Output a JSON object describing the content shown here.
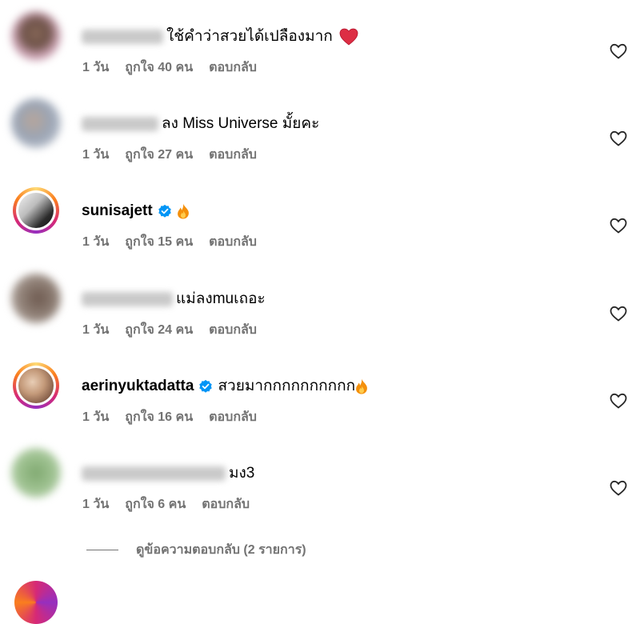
{
  "comments": [
    {
      "username": "",
      "text": "ใช้คำว่าสวยได้เปลืองมาก",
      "time": "1 วัน",
      "likes": "ถูกใจ 40 คน",
      "reply": "ตอบกลับ",
      "verified": false,
      "emoji": "red-heart"
    },
    {
      "username": "",
      "text": "ลง Miss Universe มั้ยคะ",
      "time": "1 วัน",
      "likes": "ถูกใจ 27 คน",
      "reply": "ตอบกลับ",
      "verified": false
    },
    {
      "username": "sunisajett",
      "text": "",
      "time": "1 วัน",
      "likes": "ถูกใจ 15 คน",
      "reply": "ตอบกลับ",
      "verified": true,
      "emoji": "fire"
    },
    {
      "username": "",
      "text": "แม่ลงmuเถอะ",
      "time": "1 วัน",
      "likes": "ถูกใจ 24 คน",
      "reply": "ตอบกลับ",
      "verified": false
    },
    {
      "username": "aerinyuktadatta",
      "text": "สวยมากกกกกกกกกก",
      "time": "1 วัน",
      "likes": "ถูกใจ 16 คน",
      "reply": "ตอบกลับ",
      "verified": true,
      "emoji": "fire"
    },
    {
      "username": "",
      "text": "มง3",
      "time": "1 วัน",
      "likes": "ถูกใจ 6 คน",
      "reply": "ตอบกลับ",
      "verified": false
    }
  ],
  "view_replies": "ดูข้อความตอบกลับ (2 รายการ)",
  "colors": {
    "meta_text": "#737373",
    "verified_blue": "#0095f6",
    "heart_red": "#e0245e"
  },
  "icons": {
    "like": "heart-outline-icon",
    "verified": "verified-badge-icon",
    "fire": "fire-emoji-icon",
    "red_heart": "red-heart-emoji-icon"
  }
}
